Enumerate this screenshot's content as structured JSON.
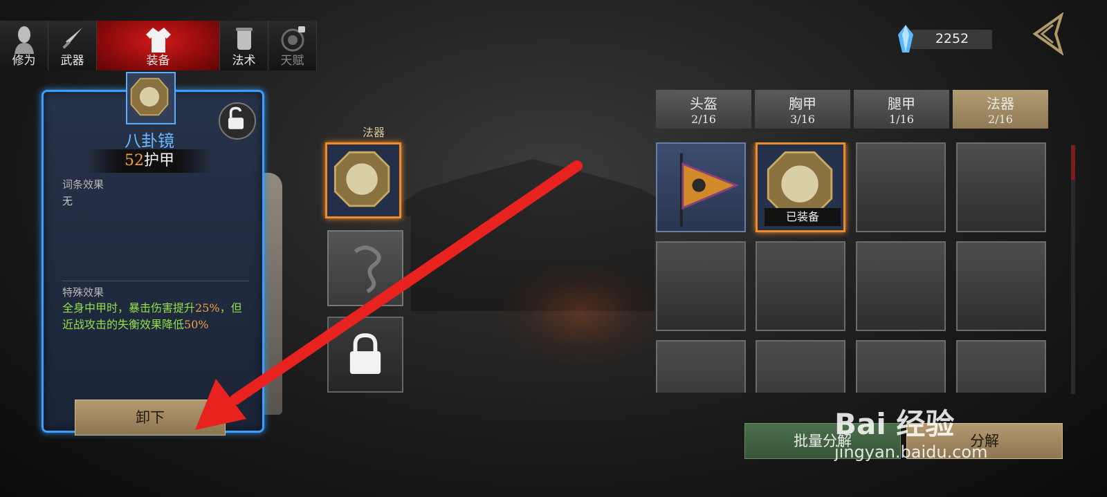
{
  "tabs": [
    {
      "label": "修为",
      "icon": "character-icon",
      "locked": false
    },
    {
      "label": "武器",
      "icon": "sword-icon",
      "locked": false
    },
    {
      "label": "装备",
      "icon": "robe-icon",
      "locked": false,
      "active": true
    },
    {
      "label": "法术",
      "icon": "scroll-icon",
      "locked": false
    },
    {
      "label": "天赋",
      "icon": "bagua-icon",
      "locked": true
    }
  ],
  "currency": {
    "value": "2252",
    "icon": "crystal-icon"
  },
  "detail": {
    "item_name": "八卦镜",
    "armor_value": "52",
    "armor_label": "护甲",
    "affix_label": "词条效果",
    "affix_value": "无",
    "special_label": "特殊效果",
    "special_text_1": "全身中甲时，暴击伤害提升",
    "special_hl_1": "25%",
    "special_text_2": "，但近战攻击的失衡效果降低",
    "special_hl_2": "50%",
    "unequip_label": "卸下"
  },
  "middle": {
    "slot_label": "法器"
  },
  "inventory": {
    "tabs": [
      {
        "title": "头盔",
        "count": "2/16"
      },
      {
        "title": "胸甲",
        "count": "3/16"
      },
      {
        "title": "腿甲",
        "count": "1/16"
      },
      {
        "title": "法器",
        "count": "2/16",
        "active": true
      }
    ],
    "equipped_label": "已装备"
  },
  "buttons": {
    "batch_decompose": "批量分解",
    "decompose": "分解"
  },
  "watermark": {
    "main": "Bai 经验",
    "sub": "jingyan.baidu.com"
  },
  "colors": {
    "accent_blue": "#3aa0ff",
    "highlight_orange": "#f08a2a",
    "effect_green": "#93e04a",
    "active_tab_red": "#d21a1a"
  }
}
